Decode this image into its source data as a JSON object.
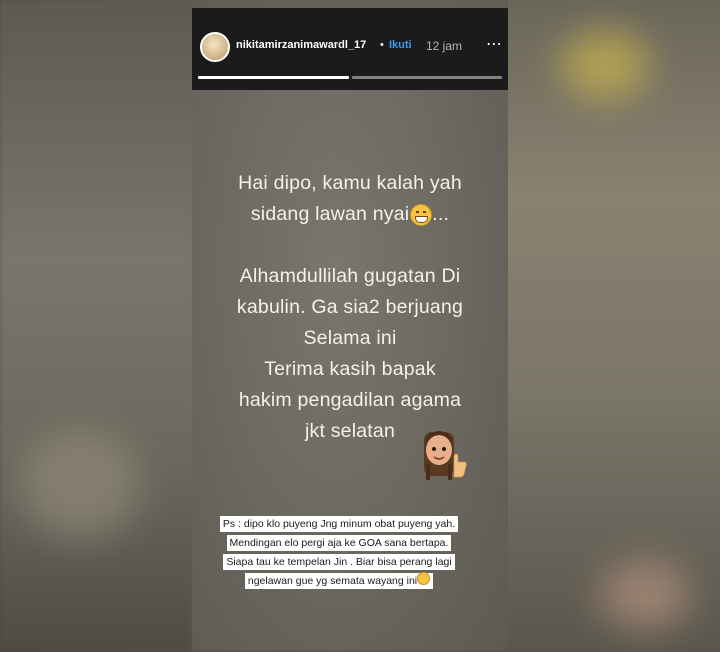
{
  "story": {
    "username": "nikitamirzanimawardl_17",
    "separator": "•",
    "follow_label": "Ikuti",
    "time": "12 jam",
    "more_icon": "⋯",
    "progress_segments": 2,
    "progress_done": 1
  },
  "main_text": {
    "line1": "Hai dipo, kamu kalah yah",
    "line2a": "sidang lawan nyai",
    "line2b": "...",
    "line3": "",
    "line4": "Alhamdullilah gugatan Di",
    "line5": "kabulin. Ga sia2 berjuang",
    "line6": "Selama ini",
    "line7": "Terima kasih bapak",
    "line8": "hakim pengadilan agama",
    "line9": "jkt  selatan"
  },
  "ps": {
    "text": "Ps : dipo klo puyeng Jng minum obat puyeng yah. Mendingan elo pergi aja ke GOA sana bertapa. Siapa tau ke tempelan Jin . Biar bisa perang lagi ngelawan gue yg semata wayang ini"
  },
  "icons": {
    "avatar": "avatar",
    "grin_emoji": "grinning-face-emoji",
    "memoji": "memoji-thumbs-up",
    "ps_emoji": "smirk-emoji"
  },
  "colors": {
    "header_bg": "#1b1b1b",
    "follow": "#3d9cf0",
    "text": "#f4f1ea"
  }
}
